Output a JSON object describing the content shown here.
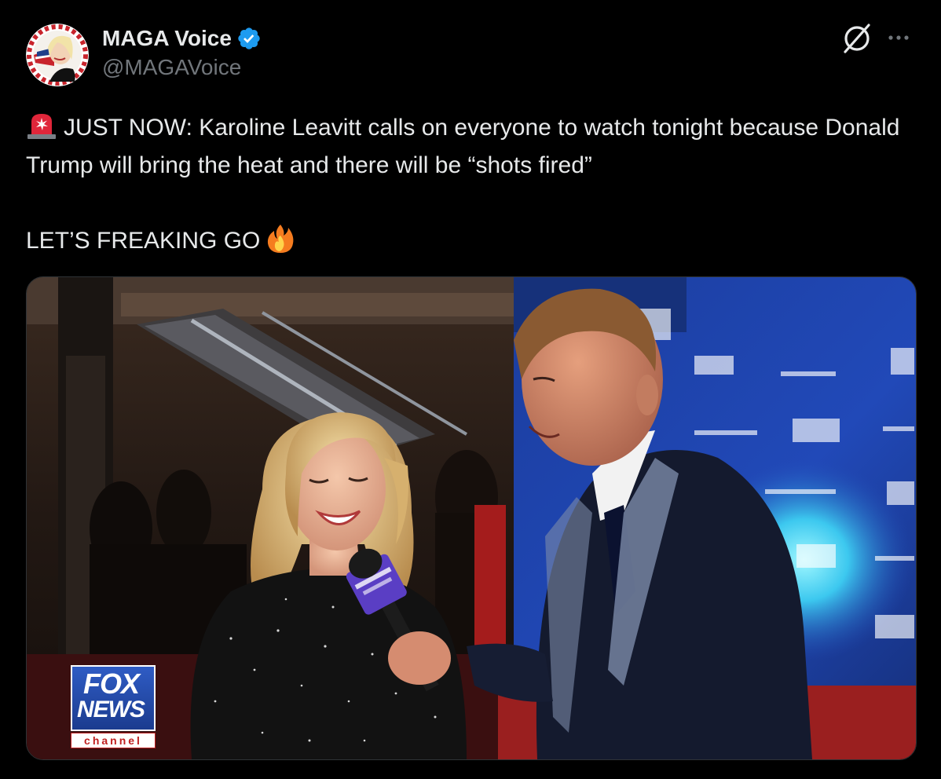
{
  "tweet": {
    "author": {
      "display_name": "MAGA Voice",
      "handle": "@MAGAVoice",
      "verified": true,
      "verified_badge_color": "#1d9bf0"
    },
    "actions": {
      "grok_icon": "grok-icon",
      "more_icon": "more-icon"
    },
    "text": {
      "line1_emoji": "rotating-light-icon",
      "line1": "JUST NOW: Karoline Leavitt calls on everyone to watch tonight because Donald Trump will bring the heat and there will be “shots fired”",
      "line2": "LET’S FREAKING GO",
      "line2_emoji": "fire-icon"
    },
    "media": {
      "type": "video",
      "overlay_logo": {
        "top": "FOX",
        "middle": "NEWS",
        "bottom": "channel"
      }
    }
  },
  "colors": {
    "background": "#000000",
    "text_primary": "#e7e9ea",
    "text_secondary": "#71767b",
    "accent_blue": "#1d9bf0"
  }
}
